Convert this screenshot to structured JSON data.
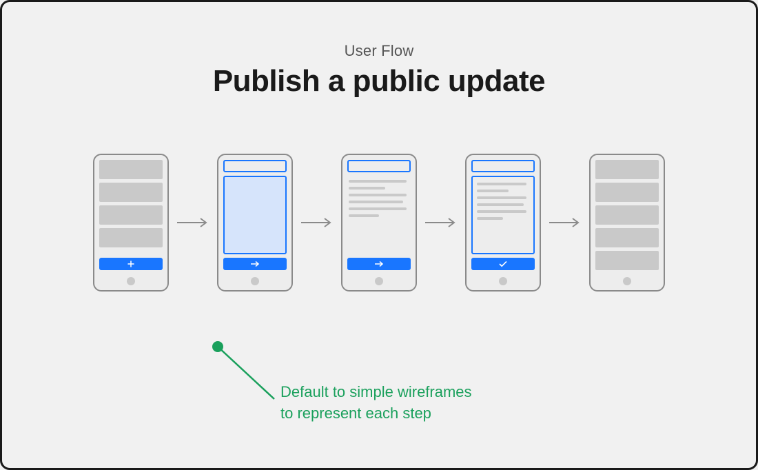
{
  "header": {
    "subtitle": "User Flow",
    "title": "Publish a public update"
  },
  "annotation": {
    "line1": "Default to simple wireframes",
    "line2": "to represent each step"
  },
  "colors": {
    "accent": "#1976ff",
    "annotation": "#1aa05c",
    "neutral": "#c9c9c9",
    "frame": "#8a8a8a"
  },
  "flow": {
    "step_count": 5,
    "steps": [
      {
        "id": "feed-with-add",
        "desc": "Feed list with add button"
      },
      {
        "id": "compose-empty",
        "desc": "Compose screen, empty textarea, next button"
      },
      {
        "id": "compose-written",
        "desc": "Compose screen with text lines, next button"
      },
      {
        "id": "confirm",
        "desc": "Review text, confirm check button"
      },
      {
        "id": "feed-updated",
        "desc": "Feed list after publishing"
      }
    ]
  }
}
